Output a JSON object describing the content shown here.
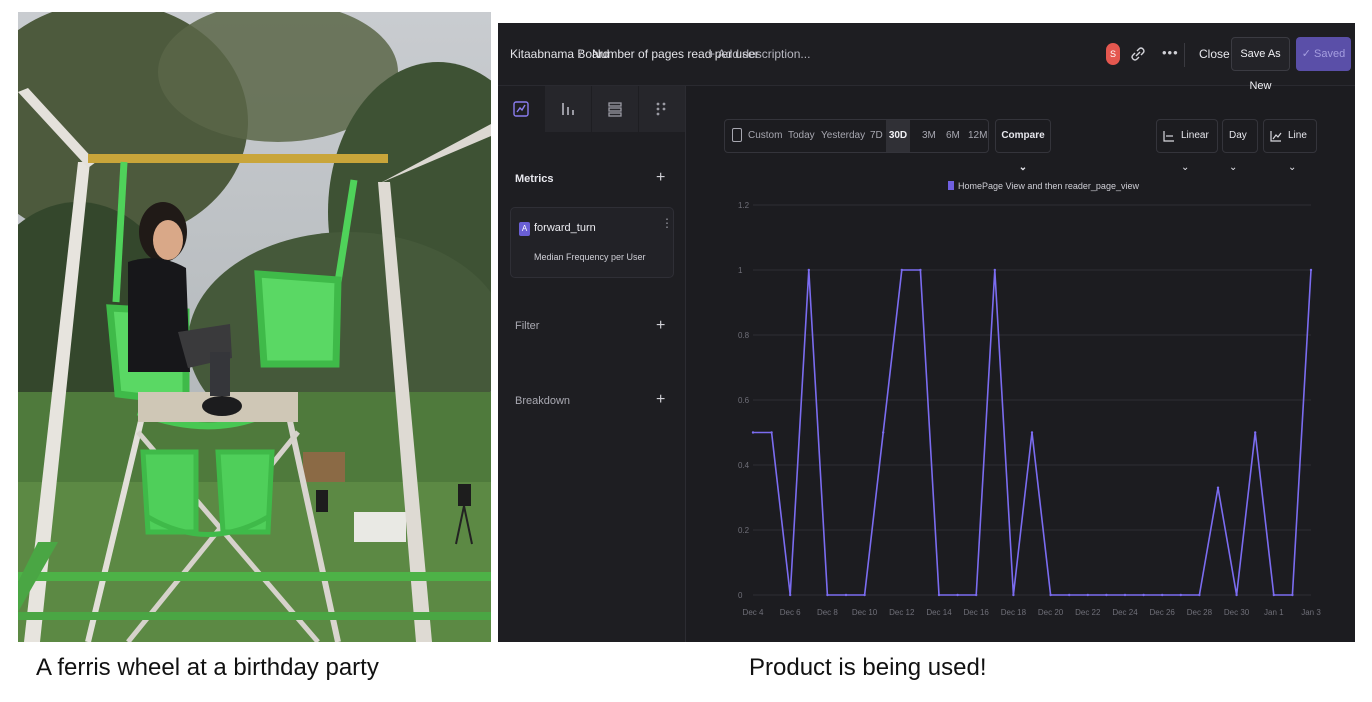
{
  "captions": {
    "left": "A ferris wheel at a birthday party",
    "right": "Product is being used!"
  },
  "app": {
    "breadcrumb": {
      "board": "Kitaabnama Board",
      "separator": "/",
      "title": "Number of pages read per user",
      "add_description": "+ Add description..."
    },
    "header": {
      "avatar_initial": "S",
      "more": "•••",
      "close": "Close",
      "save_as_new": "Save As New",
      "saved": "✓ Saved"
    },
    "sidebar": {
      "tabs": [
        "trends-icon",
        "funnel-icon",
        "flows-icon",
        "grid-icon"
      ],
      "metrics_label": "Metrics",
      "plus": "+",
      "metric": {
        "badge": "A",
        "name": "forward_turn",
        "menu": "⋮",
        "aggregation": "Median Frequency per User"
      },
      "filter_label": "Filter",
      "breakdown_label": "Breakdown"
    },
    "controls": {
      "ranges": [
        "Custom",
        "Today",
        "Yesterday",
        "7D",
        "30D",
        "3M",
        "6M",
        "12M"
      ],
      "selected_range": "30D",
      "compare": "Compare ⌄",
      "scale": "Linear ⌄",
      "interval": "Day ⌄",
      "chart_type": "Line ⌄"
    },
    "colors": {
      "background": "#1c1c20",
      "accent": "#6f5fe0",
      "line": "#7b6cf0"
    }
  },
  "chart_data": {
    "type": "line",
    "title": "",
    "xlabel": "",
    "ylabel": "",
    "legend_position": "top-center",
    "grid": true,
    "ylim": [
      0,
      1.2
    ],
    "yticks": [
      "0",
      "0.2",
      "0.4",
      "0.6",
      "0.8",
      "1",
      "1.2"
    ],
    "x_tick_labels": [
      "Dec 4",
      "Dec 6",
      "Dec 8",
      "Dec 10",
      "Dec 12",
      "Dec 14",
      "Dec 16",
      "Dec 18",
      "Dec 20",
      "Dec 22",
      "Dec 24",
      "Dec 26",
      "Dec 28",
      "Dec 30",
      "Jan 1",
      "Jan 3"
    ],
    "x": [
      "Dec 4",
      "Dec 5",
      "Dec 6",
      "Dec 7",
      "Dec 8",
      "Dec 9",
      "Dec 10",
      "Dec 11",
      "Dec 12",
      "Dec 13",
      "Dec 14",
      "Dec 15",
      "Dec 16",
      "Dec 17",
      "Dec 18",
      "Dec 19",
      "Dec 20",
      "Dec 21",
      "Dec 22",
      "Dec 23",
      "Dec 24",
      "Dec 25",
      "Dec 26",
      "Dec 27",
      "Dec 28",
      "Dec 29",
      "Dec 30",
      "Dec 31",
      "Jan 1",
      "Jan 2",
      "Jan 3"
    ],
    "series": [
      {
        "name": "HomePage View and then reader_page_view",
        "color": "#7b6cf0",
        "values": [
          0.5,
          0.5,
          0,
          1,
          0,
          0,
          0,
          0.5,
          1,
          1,
          0,
          0,
          0,
          1,
          0,
          0.5,
          0,
          0,
          0,
          0,
          0,
          0,
          0,
          0,
          0,
          0.33,
          0,
          0.5,
          0,
          0,
          1
        ]
      }
    ]
  }
}
